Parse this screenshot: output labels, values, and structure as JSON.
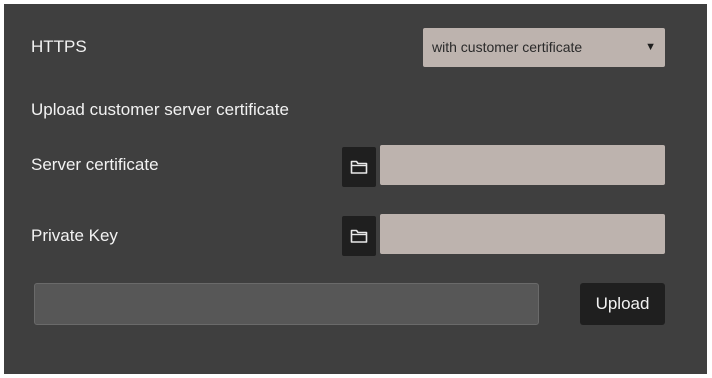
{
  "https": {
    "label": "HTTPS",
    "mode_selected": "with customer certificate"
  },
  "upload_section": {
    "heading": "Upload customer server certificate",
    "server_certificate": {
      "label": "Server certificate",
      "value": "",
      "icon": "folder-icon"
    },
    "private_key": {
      "label": "Private Key",
      "value": "",
      "icon": "folder-icon"
    },
    "progress": 0,
    "upload_label": "Upload"
  },
  "colors": {
    "panel_background": "#3f3f3f",
    "field_background": "#bdb3ae",
    "button_background": "#1f1f1f",
    "text": "#f2f2f2"
  }
}
